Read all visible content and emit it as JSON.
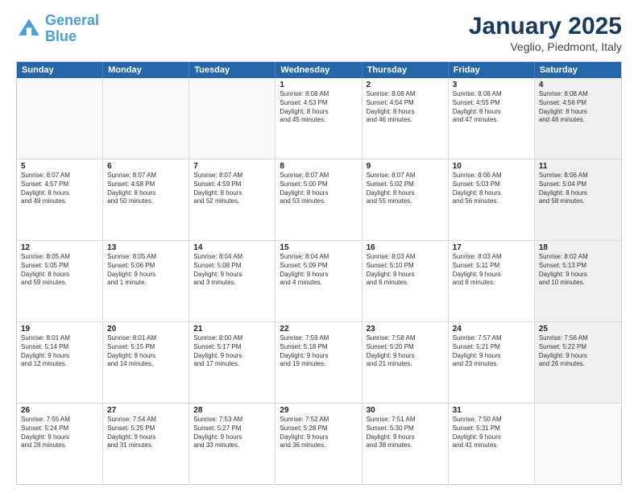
{
  "header": {
    "logo_general": "General",
    "logo_blue": "Blue",
    "title": "January 2025",
    "subtitle": "Veglio, Piedmont, Italy"
  },
  "days_of_week": [
    "Sunday",
    "Monday",
    "Tuesday",
    "Wednesday",
    "Thursday",
    "Friday",
    "Saturday"
  ],
  "weeks": [
    [
      {
        "day": "",
        "info": "",
        "empty": true
      },
      {
        "day": "",
        "info": "",
        "empty": true
      },
      {
        "day": "",
        "info": "",
        "empty": true
      },
      {
        "day": "1",
        "info": "Sunrise: 8:08 AM\nSunset: 4:53 PM\nDaylight: 8 hours\nand 45 minutes.",
        "empty": false
      },
      {
        "day": "2",
        "info": "Sunrise: 8:08 AM\nSunset: 4:54 PM\nDaylight: 8 hours\nand 46 minutes.",
        "empty": false
      },
      {
        "day": "3",
        "info": "Sunrise: 8:08 AM\nSunset: 4:55 PM\nDaylight: 8 hours\nand 47 minutes.",
        "empty": false
      },
      {
        "day": "4",
        "info": "Sunrise: 8:08 AM\nSunset: 4:56 PM\nDaylight: 8 hours\nand 48 minutes.",
        "empty": false,
        "shaded": true
      }
    ],
    [
      {
        "day": "5",
        "info": "Sunrise: 8:07 AM\nSunset: 4:57 PM\nDaylight: 8 hours\nand 49 minutes.",
        "empty": false
      },
      {
        "day": "6",
        "info": "Sunrise: 8:07 AM\nSunset: 4:58 PM\nDaylight: 8 hours\nand 50 minutes.",
        "empty": false
      },
      {
        "day": "7",
        "info": "Sunrise: 8:07 AM\nSunset: 4:59 PM\nDaylight: 8 hours\nand 52 minutes.",
        "empty": false
      },
      {
        "day": "8",
        "info": "Sunrise: 8:07 AM\nSunset: 5:00 PM\nDaylight: 8 hours\nand 53 minutes.",
        "empty": false
      },
      {
        "day": "9",
        "info": "Sunrise: 8:07 AM\nSunset: 5:02 PM\nDaylight: 8 hours\nand 55 minutes.",
        "empty": false
      },
      {
        "day": "10",
        "info": "Sunrise: 8:06 AM\nSunset: 5:03 PM\nDaylight: 8 hours\nand 56 minutes.",
        "empty": false
      },
      {
        "day": "11",
        "info": "Sunrise: 8:06 AM\nSunset: 5:04 PM\nDaylight: 8 hours\nand 58 minutes.",
        "empty": false,
        "shaded": true
      }
    ],
    [
      {
        "day": "12",
        "info": "Sunrise: 8:05 AM\nSunset: 5:05 PM\nDaylight: 8 hours\nand 59 minutes.",
        "empty": false
      },
      {
        "day": "13",
        "info": "Sunrise: 8:05 AM\nSunset: 5:06 PM\nDaylight: 9 hours\nand 1 minute.",
        "empty": false
      },
      {
        "day": "14",
        "info": "Sunrise: 8:04 AM\nSunset: 5:08 PM\nDaylight: 9 hours\nand 3 minutes.",
        "empty": false
      },
      {
        "day": "15",
        "info": "Sunrise: 8:04 AM\nSunset: 5:09 PM\nDaylight: 9 hours\nand 4 minutes.",
        "empty": false
      },
      {
        "day": "16",
        "info": "Sunrise: 8:03 AM\nSunset: 5:10 PM\nDaylight: 9 hours\nand 6 minutes.",
        "empty": false
      },
      {
        "day": "17",
        "info": "Sunrise: 8:03 AM\nSunset: 5:11 PM\nDaylight: 9 hours\nand 8 minutes.",
        "empty": false
      },
      {
        "day": "18",
        "info": "Sunrise: 8:02 AM\nSunset: 5:13 PM\nDaylight: 9 hours\nand 10 minutes.",
        "empty": false,
        "shaded": true
      }
    ],
    [
      {
        "day": "19",
        "info": "Sunrise: 8:01 AM\nSunset: 5:14 PM\nDaylight: 9 hours\nand 12 minutes.",
        "empty": false
      },
      {
        "day": "20",
        "info": "Sunrise: 8:01 AM\nSunset: 5:15 PM\nDaylight: 9 hours\nand 14 minutes.",
        "empty": false
      },
      {
        "day": "21",
        "info": "Sunrise: 8:00 AM\nSunset: 5:17 PM\nDaylight: 9 hours\nand 17 minutes.",
        "empty": false
      },
      {
        "day": "22",
        "info": "Sunrise: 7:59 AM\nSunset: 5:18 PM\nDaylight: 9 hours\nand 19 minutes.",
        "empty": false
      },
      {
        "day": "23",
        "info": "Sunrise: 7:58 AM\nSunset: 5:20 PM\nDaylight: 9 hours\nand 21 minutes.",
        "empty": false
      },
      {
        "day": "24",
        "info": "Sunrise: 7:57 AM\nSunset: 5:21 PM\nDaylight: 9 hours\nand 23 minutes.",
        "empty": false
      },
      {
        "day": "25",
        "info": "Sunrise: 7:56 AM\nSunset: 5:22 PM\nDaylight: 9 hours\nand 26 minutes.",
        "empty": false,
        "shaded": true
      }
    ],
    [
      {
        "day": "26",
        "info": "Sunrise: 7:55 AM\nSunset: 5:24 PM\nDaylight: 9 hours\nand 28 minutes.",
        "empty": false
      },
      {
        "day": "27",
        "info": "Sunrise: 7:54 AM\nSunset: 5:25 PM\nDaylight: 9 hours\nand 31 minutes.",
        "empty": false
      },
      {
        "day": "28",
        "info": "Sunrise: 7:53 AM\nSunset: 5:27 PM\nDaylight: 9 hours\nand 33 minutes.",
        "empty": false
      },
      {
        "day": "29",
        "info": "Sunrise: 7:52 AM\nSunset: 5:28 PM\nDaylight: 9 hours\nand 36 minutes.",
        "empty": false
      },
      {
        "day": "30",
        "info": "Sunrise: 7:51 AM\nSunset: 5:30 PM\nDaylight: 9 hours\nand 38 minutes.",
        "empty": false
      },
      {
        "day": "31",
        "info": "Sunrise: 7:50 AM\nSunset: 5:31 PM\nDaylight: 9 hours\nand 41 minutes.",
        "empty": false
      },
      {
        "day": "",
        "info": "",
        "empty": true,
        "shaded": true
      }
    ]
  ]
}
